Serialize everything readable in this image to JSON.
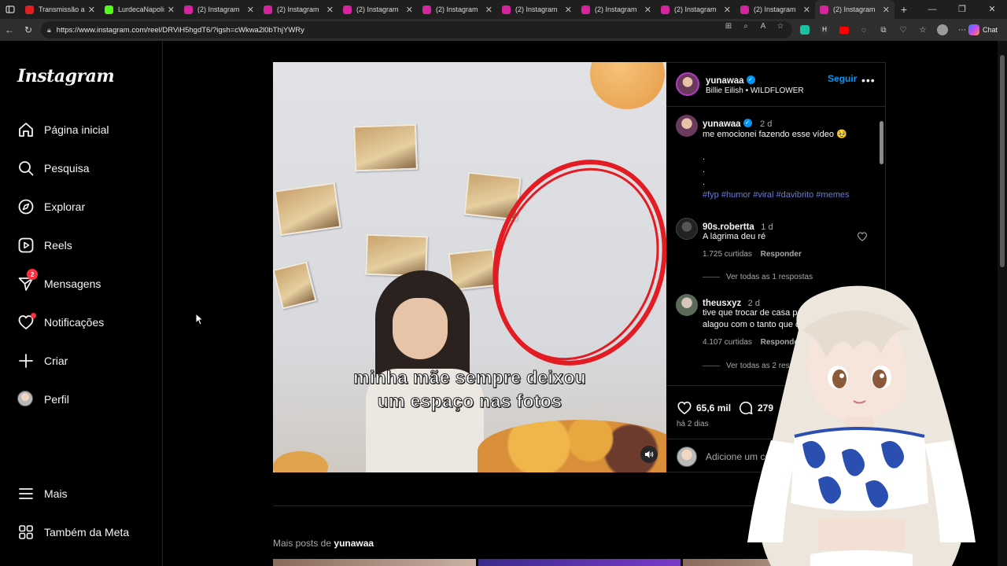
{
  "browser": {
    "tabs": [
      {
        "title": "Transmissão ao vivo",
        "favicon_color": "#e02020",
        "active": false
      },
      {
        "title": "LurdecaNapolis",
        "favicon_color": "#53fc18",
        "active": false
      },
      {
        "title": "(2) Instagram",
        "favicon_color": "#d6249f",
        "active": false
      },
      {
        "title": "(2) Instagram",
        "favicon_color": "#d6249f",
        "active": false
      },
      {
        "title": "(2) Instagram",
        "favicon_color": "#d6249f",
        "active": false
      },
      {
        "title": "(2) Instagram",
        "favicon_color": "#d6249f",
        "active": false
      },
      {
        "title": "(2) Instagram",
        "favicon_color": "#d6249f",
        "active": false
      },
      {
        "title": "(2) Instagram",
        "favicon_color": "#d6249f",
        "active": false
      },
      {
        "title": "(2) Instagram",
        "favicon_color": "#d6249f",
        "active": false
      },
      {
        "title": "(2) Instagram",
        "favicon_color": "#d6249f",
        "active": false
      },
      {
        "title": "(2) Instagram",
        "favicon_color": "#d6249f",
        "active": true
      }
    ],
    "url": "https://www.instagram.com/reel/DRViH5hgdT6/?igsh=cWkwa2l0bThjYWRy",
    "chat_label": "Chat"
  },
  "nav": {
    "logo": "Instagram",
    "items": [
      {
        "label": "Página inicial",
        "icon": "home-icon"
      },
      {
        "label": "Pesquisa",
        "icon": "search-icon"
      },
      {
        "label": "Explorar",
        "icon": "compass-icon"
      },
      {
        "label": "Reels",
        "icon": "reels-icon"
      },
      {
        "label": "Mensagens",
        "icon": "messages-icon",
        "badge": "2"
      },
      {
        "label": "Notificações",
        "icon": "heart-icon"
      },
      {
        "label": "Criar",
        "icon": "plus-icon"
      },
      {
        "label": "Perfil",
        "icon": "avatar"
      },
      {
        "label": "Mais",
        "icon": "menu-icon"
      },
      {
        "label": "Também da Meta",
        "icon": "meta-icon"
      }
    ]
  },
  "video": {
    "caption_line1": "minha mãe sempre deixou",
    "caption_line2": "um espaço nas fotos"
  },
  "post": {
    "username": "yunawaa",
    "follow_label": "Seguir",
    "audio": "Billie Eilish • WILDFLOWER",
    "caption_time": "2 d",
    "caption_text": "me emocionei fazendo esse vídeo 🥹",
    "caption_dots": [
      ".",
      ".",
      "."
    ],
    "hashtags": "#fyp #humor #viral #davibrito #memes",
    "comments": [
      {
        "username": "90s.robertta",
        "time": "1 d",
        "text": "A lágrima deu ré",
        "likes": "1.725 curtidas",
        "reply_label": "Responder",
        "view_replies": "Ver todas as 1 respostas"
      },
      {
        "username": "theusxyz",
        "time": "2 d",
        "text_line1": "tive que trocar de casa pq a",
        "text_line2": "alagou com o tanto que ch",
        "likes": "4.107 curtidas",
        "reply_label": "Responder",
        "view_replies": "Ver todas as 2 respo"
      }
    ],
    "like_count": "65,6 mil",
    "comment_count": "279",
    "posted_ago": "há 2 dias",
    "add_comment_placeholder": "Adicione um co"
  },
  "more_posts": {
    "prefix": "Mais posts de",
    "username": "yunawaa"
  }
}
